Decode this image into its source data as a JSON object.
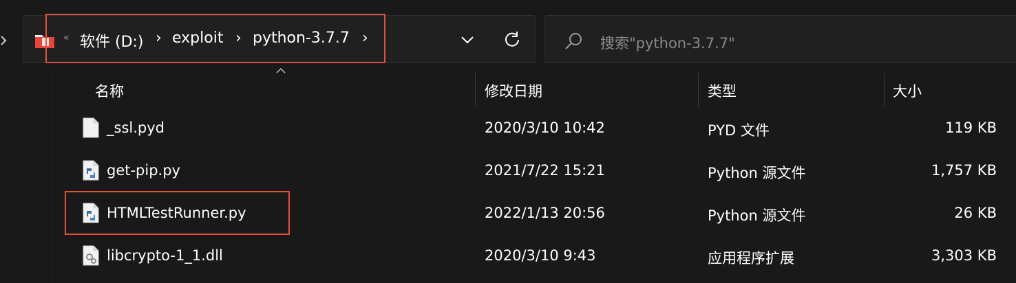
{
  "breadcrumb": {
    "overflow_glyph": "«",
    "items": [
      "软件 (D:)",
      "exploit",
      "python-3.7.7"
    ],
    "separator": "›"
  },
  "search": {
    "placeholder": "搜索\"python-3.7.7\""
  },
  "columns": {
    "name": "名称",
    "modified": "修改日期",
    "type": "类型",
    "size": "大小"
  },
  "files": [
    {
      "name": "_ssl.pyd",
      "modified": "2020/3/10 10:42",
      "type": "PYD 文件",
      "size": "119 KB",
      "icon": "blank-file-icon"
    },
    {
      "name": "get-pip.py",
      "modified": "2021/7/22 15:21",
      "type": "Python 源文件",
      "size": "1,757 KB",
      "icon": "python-file-icon"
    },
    {
      "name": "HTMLTestRunner.py",
      "modified": "2022/1/13 20:56",
      "type": "Python 源文件",
      "size": "26 KB",
      "icon": "python-file-icon"
    },
    {
      "name": "libcrypto-1_1.dll",
      "modified": "2020/3/10 9:43",
      "type": "应用程序扩展",
      "size": "3,303 KB",
      "icon": "dll-file-icon"
    }
  ],
  "colors": {
    "background": "#191919",
    "highlight": "#e0523f",
    "folder": "#e8443a"
  }
}
